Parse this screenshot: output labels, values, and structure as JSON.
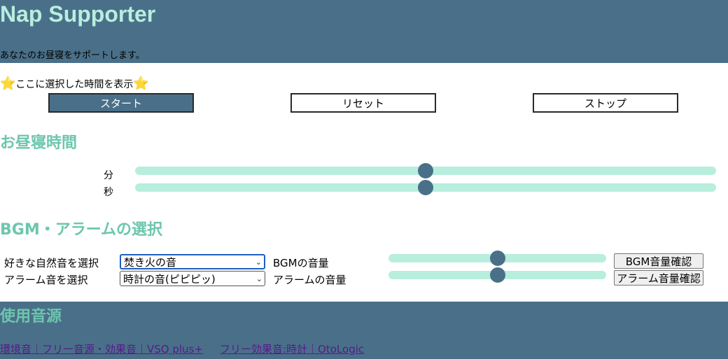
{
  "header": {
    "title": "Nap Supporter",
    "subtitle": "あなたのお昼寝をサポートします。"
  },
  "timer": {
    "selected_time_text": "ここに選択した時間を表示",
    "star_glyph": "⭐",
    "buttons": {
      "start": "スタート",
      "reset": "リセット",
      "stop": "ストップ"
    }
  },
  "nap_time": {
    "title": "お昼寝時間",
    "minutes_label": "分",
    "seconds_label": "秒",
    "minutes_level": 0.5,
    "seconds_level": 0.5
  },
  "bgm_alarm": {
    "title": "BGM・アラームの選択",
    "nature_sound_label": "好きな自然音を選択",
    "nature_sound_selected": "焚き火の音",
    "alarm_sound_label": "アラーム音を選択",
    "alarm_sound_selected": "時計の音(ピピピッ)",
    "bgm_volume_label": "BGMの音量",
    "alarm_volume_label": "アラームの音量",
    "bgm_volume_level": 0.5,
    "alarm_volume_level": 0.5,
    "bgm_confirm_button": "BGM音量確認",
    "alarm_confirm_button": "アラーム音量確認"
  },
  "sources": {
    "title": "使用音源",
    "links": [
      "環境音｜フリー音源・効果音｜VSQ plus+",
      "フリー効果音:時計｜OtoLogic"
    ]
  },
  "colors": {
    "header_bg": "#4a7089",
    "title_text": "#b8eedd",
    "section_title": "#6dc6ad",
    "slider_track": "#b8eedd",
    "slider_thumb": "#4a7089",
    "visited_link": "#551a8b"
  }
}
